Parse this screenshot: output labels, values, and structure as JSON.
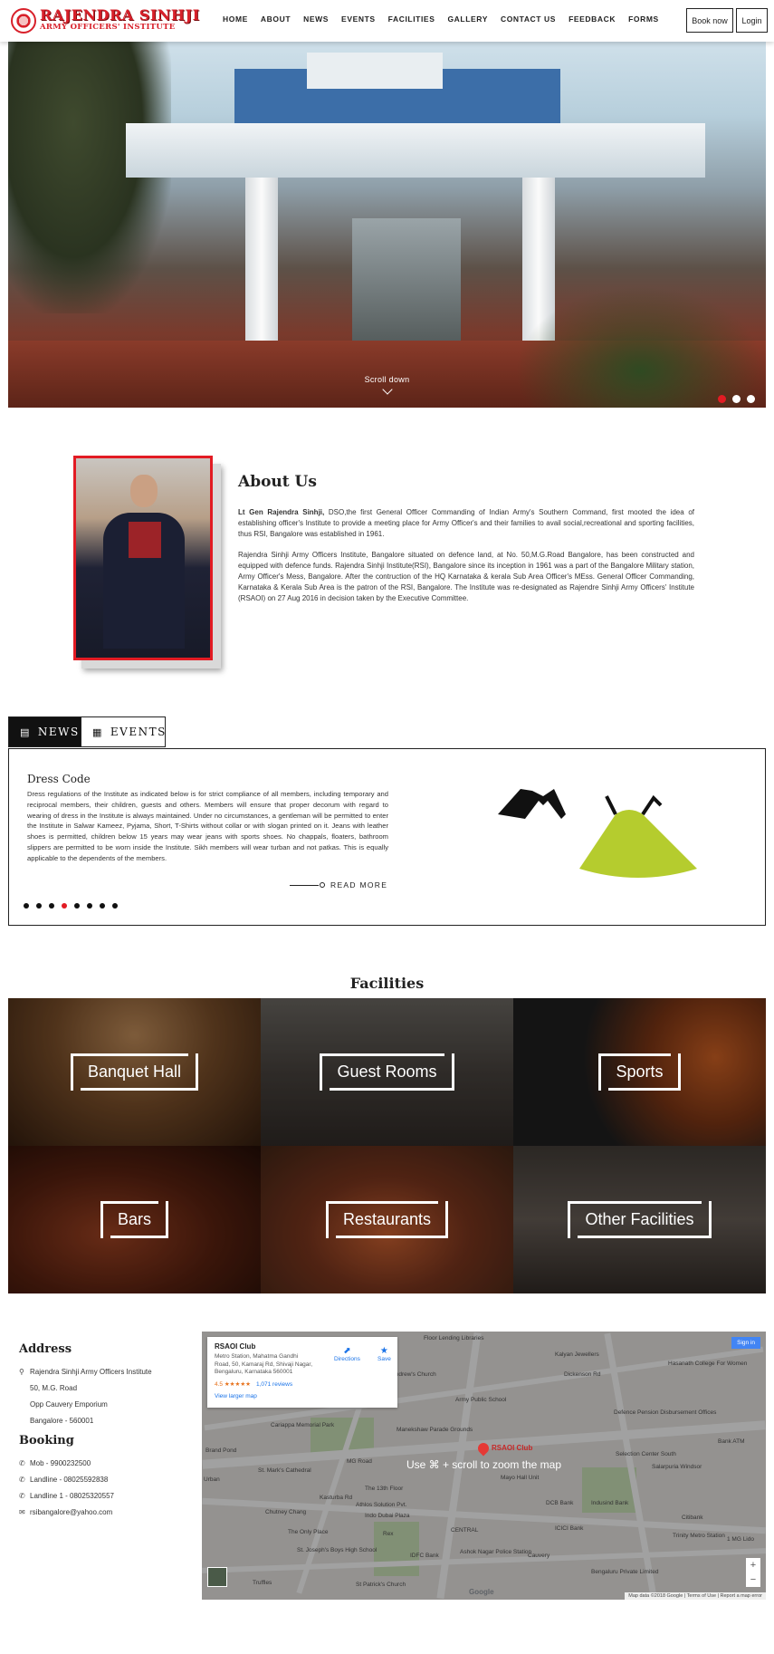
{
  "header": {
    "logo_line1": "RAJENDRA SINHJI",
    "logo_line2": "ARMY OFFICERS' INSTITUTE",
    "nav": [
      "HOME",
      "ABOUT",
      "NEWS",
      "EVENTS",
      "FACILITIES",
      "GALLERY",
      "CONTACT US",
      "FEEDBACK",
      "FORMS"
    ],
    "book_now": "Book now",
    "login": "Login"
  },
  "hero": {
    "scroll_label": "Scroll down",
    "slides": 3,
    "active_slide": 1
  },
  "about": {
    "title": "About Us",
    "p1_bold": "Lt Gen Rajendra Sinhji,",
    "p1_rest": " DSO,the first General Officer Commanding of Indian Army's Southern Command, first mooted the idea of establishing officer's Institute to provide a meeting place for Army Officer's and their families to avail social,recreational and sporting facilities, thus RSI, Bangalore was established in 1961.",
    "p2": "Rajendra Sinhji Army Officers Institute, Bangalore situated on defence land, at No. 50,M.G.Road Bangalore, has been constructed and equipped with defence funds. Rajendra Sinhji Institute(RSI), Bangalore since its inception in 1961 was a part of the Bangalore Military station, Army Officer's Mess, Bangalore. After the contruction of the HQ Karnataka & kerala Sub Area Officer's MEss. General Officer Commanding, Karnataka & Kerala Sub Area is the patron of the RSI, Bangalore. The Institute was re-designated as Rajendre Sinhji Army Officers' Institute (RSAOI) on 27 Aug 2016 in decision taken by the Executive Committee."
  },
  "news": {
    "tab_news": "NEWS",
    "tab_events": "EVENTS",
    "item_title": "Dress Code",
    "item_body": "Dress regulations of the Institute as indicated below is for strict compliance of all members, including temporary and reciprocal members, their children, guests and others. Members will ensure that proper decorum with regard to wearing of dress in the Institute is always maintained. Under no circumstances, a gentleman will be permitted to enter the Institute in Salwar Kameez, Pyjama, Short, T-Shirts without collar or with slogan printed on it. Jeans with leather shoes is permitted, children below 15 years may wear jeans with sports shoes. No chappals, floaters, bathroom slippers are permitted to be worn inside the Institute. Sikh members will wear turban and not patkas. This is equally applicable to the dependents of the members.",
    "read_more": "READ MORE",
    "dots": 8,
    "active_dot": 3
  },
  "facilities": {
    "title": "Facilities",
    "items": [
      "Banquet Hall",
      "Guest Rooms",
      "Sports",
      "Bars",
      "Restaurants",
      "Other Facilities"
    ]
  },
  "contact": {
    "address_title": "Address",
    "address_lines": [
      "Rajendra Sinhji Army Officers Institute",
      "50, M.G. Road",
      "Opp Cauvery Emporium",
      "Bangalore - 560001"
    ],
    "booking_title": "Booking",
    "booking_lines": [
      "Mob - 9900232500",
      "Landline - 08025592838",
      "Landline 1 - 08025320557",
      "rsibangalore@yahoo.com"
    ]
  },
  "map": {
    "hint": "Use ⌘ + scroll to zoom the map",
    "place_name": "RSAOI Club",
    "place_address": "Metro Station, Mahatma Gandhi Road, 50, Kamaraj Rd, Shivaji Nagar, Bengaluru, Karnataka 560001",
    "rating": "4.5 ★★★★★",
    "reviews": "1,071 reviews",
    "directions": "Directions",
    "save": "Save",
    "larger_map": "View larger map",
    "sign_in": "Sign in",
    "pin_label": "RSAOI Club",
    "attribution": "Map data ©2018 Google | Terms of Use | Report a map error",
    "labels": [
      "Floor Lending Libraries",
      "Kalyan Jewellers",
      "Dickenson Rd",
      "Hasanath College For Women",
      "Army Public School",
      "Defence Pension Disbursement Offices",
      "St. Andrew's Church",
      "Manekshaw Parade Grounds",
      "Cariappa Memorial Park",
      "St. Mark's Cathedral",
      "Selection Center South",
      "Salarpuria Windsor",
      "The 13th Floor",
      "Mayo Hall Unit",
      "Athlos Solution Pvt.",
      "Indo Dubai Plaza",
      "DCB Bank",
      "Indusind Bank",
      "ICICI Bank",
      "Citibank",
      "CENTRAL",
      "Ashok Nagar Police Station",
      "St. Joseph's Boys High School",
      "St Patrick's Church",
      "Truffles",
      "Chutney Chang",
      "The Only Place",
      "IDFC Bank",
      "MG Road",
      "Rex",
      "Kasturba Rd",
      "Trinity Metro Station",
      "Bank ATM",
      "Urban",
      "1 MG Lido",
      "Bengaluru Private Limited",
      "Cauvery",
      "Brand Pond"
    ]
  }
}
